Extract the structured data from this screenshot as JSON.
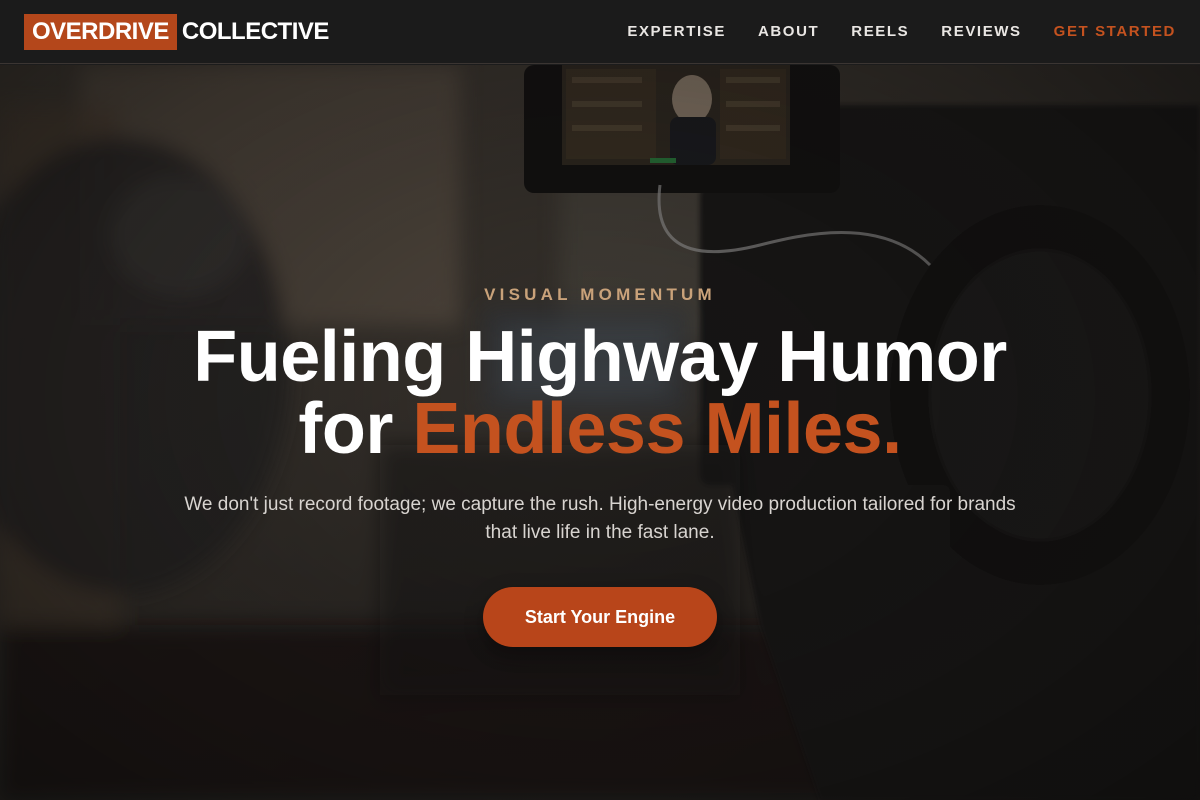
{
  "brand": {
    "logo_highlight": "OVERDRIVE",
    "logo_rest": "COLLECTIVE",
    "accent_color": "#b4471b"
  },
  "nav": {
    "items": [
      {
        "label": "EXPERTISE"
      },
      {
        "label": "ABOUT"
      },
      {
        "label": "REELS"
      },
      {
        "label": "REVIEWS"
      },
      {
        "label": "GET STARTED"
      }
    ]
  },
  "hero": {
    "eyebrow": "VISUAL MOMENTUM",
    "headline_line1": "Fueling Highway Humor",
    "headline_line2_prefix": "for ",
    "headline_line2_accent": "Endless Miles.",
    "subtext": "We don't just record footage; we capture the rush. High-energy video production tailored for brands that live life in the fast lane.",
    "cta_label": "Start Your Engine",
    "background_image": "camera-monitor-interview-photo"
  }
}
